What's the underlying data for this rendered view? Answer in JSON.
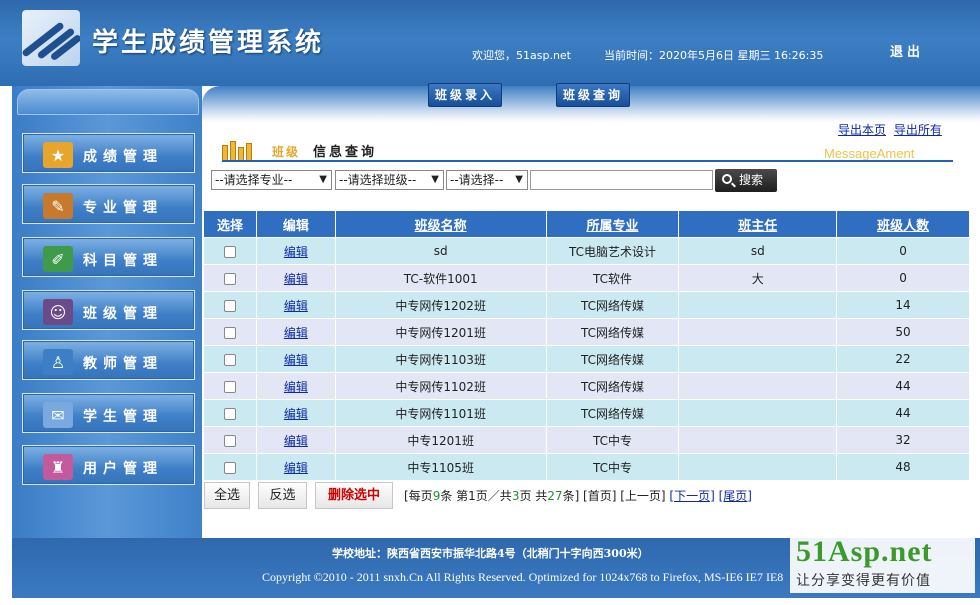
{
  "header": {
    "title": "学生成绩管理系统",
    "welcome": "欢迎您，51asp.net",
    "current_time": "当前时间：2020年5月6日 星期三 16:26:35",
    "logout": "退出"
  },
  "sidebar": {
    "items": [
      {
        "label": "成绩管理",
        "icon": "grades-icon"
      },
      {
        "label": "专业管理",
        "icon": "major-icon"
      },
      {
        "label": "科目管理",
        "icon": "subject-icon"
      },
      {
        "label": "班级管理",
        "icon": "class-icon"
      },
      {
        "label": "教师管理",
        "icon": "teacher-icon"
      },
      {
        "label": "学生管理",
        "icon": "student-icon"
      },
      {
        "label": "用户管理",
        "icon": "user-icon"
      }
    ]
  },
  "tabs": {
    "class_entry": "班级录入",
    "class_query": "班级查询"
  },
  "export": {
    "export_page": "导出本页",
    "export_all": "导出所有"
  },
  "section": {
    "sub": "班级",
    "title": "信息查询",
    "message": "MessageAment"
  },
  "filters": {
    "major": "--请选择专业--",
    "class": "--请选择班级--",
    "other": "--请选择--",
    "search_placeholder": "",
    "search_button": "搜索"
  },
  "table": {
    "headers": [
      "选择",
      "编辑",
      "班级名称",
      "所属专业",
      "班主任",
      "班级人数"
    ],
    "edit_label": "编辑",
    "rows": [
      {
        "name": "sd",
        "major": "TC电脑艺术设计",
        "teacher": "sd",
        "count": "0"
      },
      {
        "name": "TC-软件1001",
        "major": "TC软件",
        "teacher": "大",
        "count": "0"
      },
      {
        "name": "中专网传1202班",
        "major": "TC网络传媒",
        "teacher": "",
        "count": "14"
      },
      {
        "name": "中专网传1201班",
        "major": "TC网络传媒",
        "teacher": "",
        "count": "50"
      },
      {
        "name": "中专网传1103班",
        "major": "TC网络传媒",
        "teacher": "",
        "count": "22"
      },
      {
        "name": "中专网传1102班",
        "major": "TC网络传媒",
        "teacher": "",
        "count": "44"
      },
      {
        "name": "中专网传1101班",
        "major": "TC网络传媒",
        "teacher": "",
        "count": "44"
      },
      {
        "name": "中专1201班",
        "major": "TC中专",
        "teacher": "",
        "count": "32"
      },
      {
        "name": "中专1105班",
        "major": "TC中专",
        "teacher": "",
        "count": "48"
      }
    ]
  },
  "actions": {
    "select_all": "全选",
    "invert": "反选",
    "delete_selected": "删除选中"
  },
  "pager": {
    "p1": "[每页",
    "per_page": "9",
    "p2": "条 第",
    "current": "1",
    "p3": "页／共",
    "total_pages": "3",
    "p4": "页 共",
    "total": "27",
    "p5": "条] [首页] [上一页] ",
    "next": "[下一页]",
    "last": "[尾页]"
  },
  "footer": {
    "address": "学校地址：陕西省西安市振华北路4号（北稍门十字向西300米）",
    "copyright": "Copyright ©2010 - 2011 snxh.Cn All Rights Reserved. Optimized for 1024x768 to Firefox, MS-IE6 IE7 IE8"
  },
  "watermark": {
    "brand": "51Asp.net",
    "tagline": "让分享变得更有价值"
  },
  "colors": {
    "header_blue": "#2e68ab",
    "table_header": "#2f6ec0",
    "row_odd": "#cbe9f1",
    "row_even": "#e2e6f5",
    "link": "#0c2aa8",
    "delete_red": "#d40000",
    "brand_green": "#3c9a2c"
  }
}
